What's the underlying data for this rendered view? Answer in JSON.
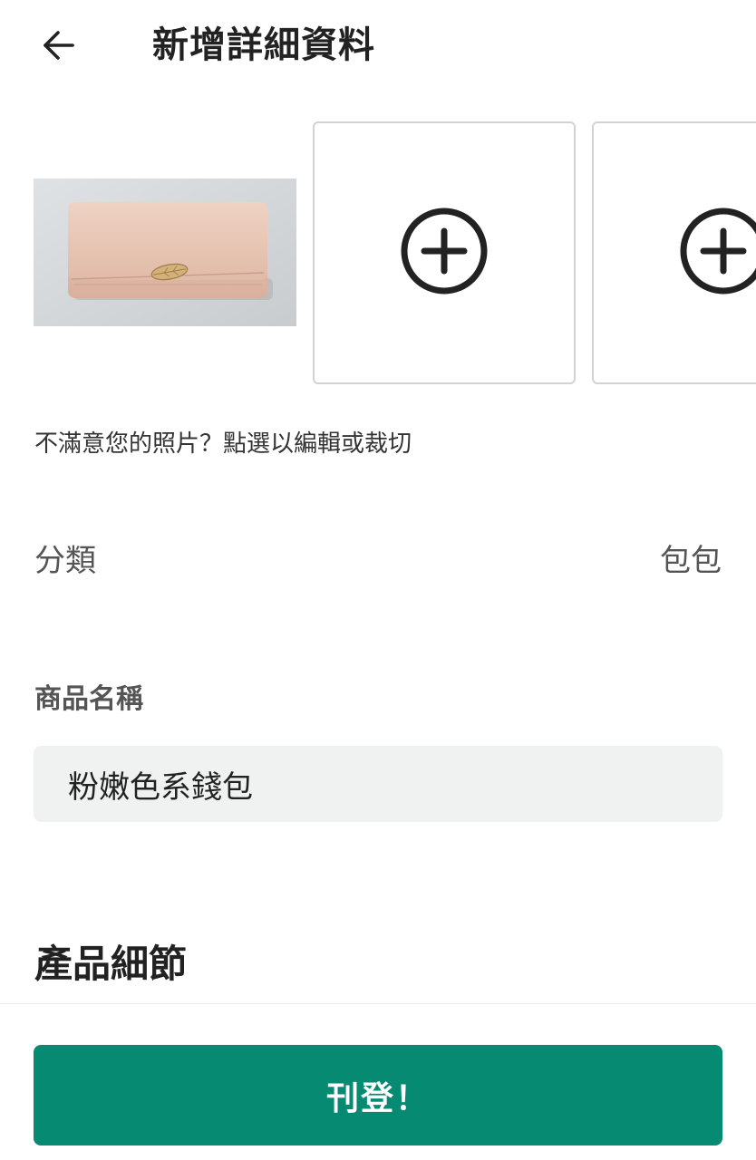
{
  "header": {
    "back_icon": "arrow-left-icon",
    "title": "新增詳細資料"
  },
  "photos": {
    "main_photo_alt": "wallet-photo",
    "add_icon": "plus-circle-icon",
    "hint": "不滿意您的照片？點選以編輯或裁切"
  },
  "category": {
    "label": "分類",
    "value": "包包"
  },
  "product_name": {
    "label": "商品名稱",
    "value": "粉嫩色系錢包"
  },
  "details": {
    "title": "產品細節"
  },
  "footer": {
    "publish_label": "刊登！"
  },
  "colors": {
    "accent": "#078a72",
    "input_bg": "#f0f2f2",
    "tile_border": "#d2d2d2"
  }
}
